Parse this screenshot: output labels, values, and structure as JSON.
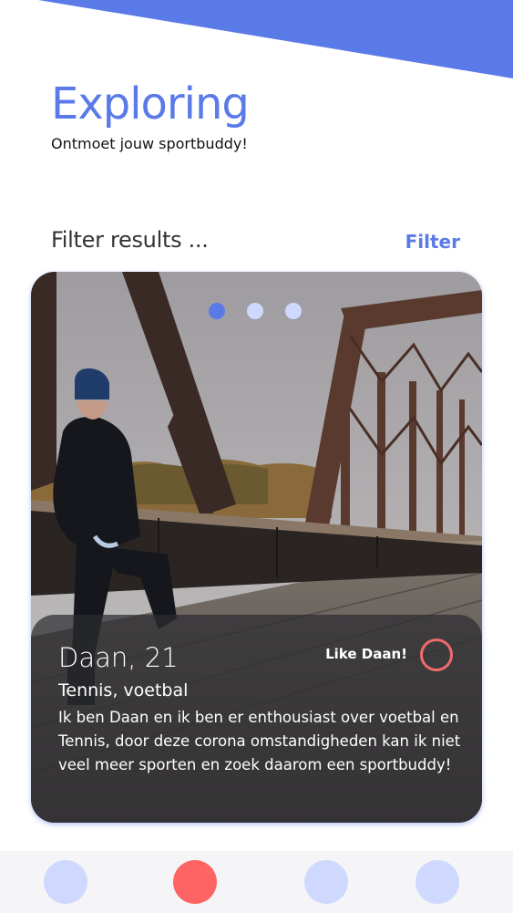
{
  "header": {
    "title": "Exploring",
    "subtitle": "Ontmoet jouw sportbuddy!"
  },
  "filter": {
    "label": "Filter results ...",
    "button_label": "Filter"
  },
  "card": {
    "name_age": "Daan, 21",
    "sports": "Tennis, voetbal",
    "bio": "Ik ben Daan en ik ben er enthousiast over voetbal en Tennis, door deze corona omstandigheden kan ik niet veel meer sporten en zoek daarom een sportbuddy!",
    "like_label": "Like Daan!",
    "carousel": {
      "count": 3,
      "active_index": 0
    }
  },
  "bottom_nav": {
    "active_index": 1,
    "count": 4
  },
  "colors": {
    "accent": "#5a7ae8",
    "accent_light": "#cfd8ff",
    "like": "#f06b6b",
    "nav_active": "#ff6464"
  }
}
